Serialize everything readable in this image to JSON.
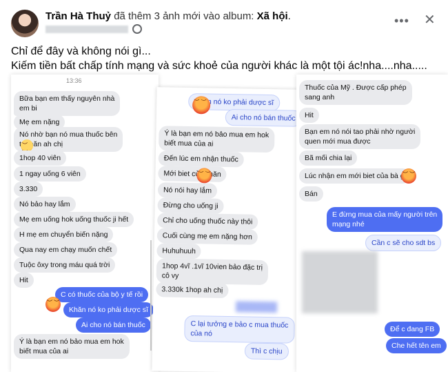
{
  "post": {
    "author": "Trần Hà Thuỷ",
    "action": "đã thêm 3 ảnh mới vào album:",
    "album": "Xã hội",
    "album_suffix": ".",
    "more_icon": "more-dots-icon",
    "close_icon": "close-icon",
    "caption_line1": "Chỉ để đây và không nói gì...",
    "caption_line2": "Kiếm tiền bất chấp tính mạng và sức khoẻ của người khác là một tội ác!nha....nha....."
  },
  "panel1": {
    "time": "13:36",
    "messages": [
      "Bữa bạn em thấy nguyên nhà",
      "em bi",
      "Mẹ em nặng",
      "Nó nhờ bạn nó mua thuốc bên",
      "tr      khăn ah chị",
      "1hop 40 viên",
      "1 ngay uống 6 viên",
      "3.330",
      "Nó bảo hay lắm",
      "Mẹ em uống hok uống thuốc ji hết",
      "H mẹ em chuyển biến nặng",
      "Qua nay em chạy muốn chết",
      "Tuộc ôxy trong máu quá trời",
      "Hit",
      "C có thuốc của bộ y tế rồi",
      "Khăn nó ko phải dược sĩ",
      "Ai cho nó bán thuốc",
      "Ý là bạn em nó bảo mua em hok",
      "biết mua của ai"
    ]
  },
  "panel2": {
    "messages": [
      "Khăn nó ko phải dược sĩ",
      "Ai cho nó bán thuốc",
      "Ý là bạn em nó bảo mua em hok",
      "biết mua của ai",
      "Đến lúc em nhận thuốc",
      "Mới biet của      khăn",
      "Nó nói hay lắm",
      "Đừng cho uống ji",
      "Chỉ cho uống thuốc này thôi",
      "Cuối cùng mẹ em nặng hơn",
      "Huhuhuuh",
      "1hop 4vĩ .1vĩ 10vien bảo đặc trị",
      "cô vy",
      "3.330k 1hop ah chị",
      "C lại tưởng e bảo c mua thuốc",
      "của nó",
      "Thì c chịu"
    ]
  },
  "panel3": {
    "messages": [
      "Thuốc của Mỹ . Được cấp phép",
      "sang anh",
      "Hit",
      "Bạn em nó nói tao phải nhờ người",
      "quen mới mua được",
      "Bã mối chia lại",
      "Lúc nhận em mới biet của bà      g",
      "Bán",
      "E đừng mua của mấy người trên",
      "mạng nhé",
      "Cần c sẽ cho sdt bs",
      "Để c đang FB",
      "Che hết tên em"
    ]
  },
  "colors": {
    "outgoing": "#4e6ef2",
    "incoming": "#e9eaed",
    "accent_blue": "#2a45c8"
  }
}
